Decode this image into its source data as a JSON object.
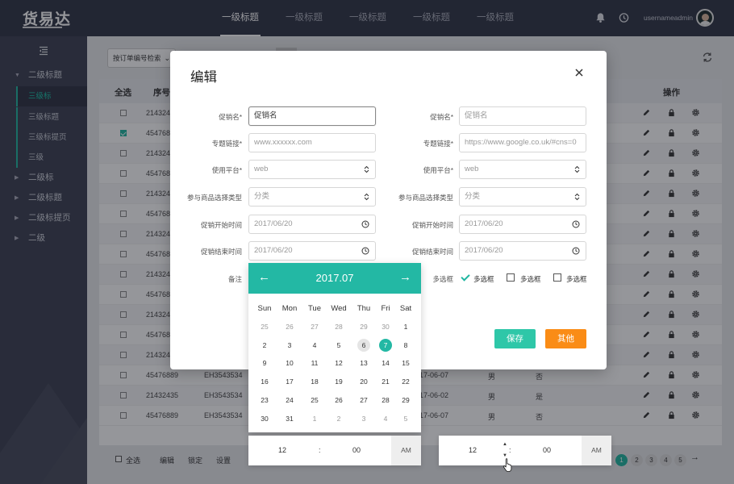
{
  "app": {
    "logo": "货易达",
    "username": "usernameadmin"
  },
  "topnav": [
    "一级标题",
    "一级标题",
    "一级标题",
    "一级标题",
    "一级标题"
  ],
  "sidebar": {
    "groups": [
      {
        "label": "二级标题",
        "expanded": true,
        "children": [
          "三级标",
          "三级标题",
          "三级标提页",
          "三级"
        ]
      },
      {
        "label": "二级标",
        "expanded": false
      },
      {
        "label": "二级标题",
        "expanded": false
      },
      {
        "label": "二级标提页",
        "expanded": false
      },
      {
        "label": "二级",
        "expanded": false
      }
    ]
  },
  "search": {
    "select_label": "按订单编号检索"
  },
  "table": {
    "headers": {
      "select_all": "全选",
      "index": "序号",
      "ops": "操作"
    },
    "rows": [
      {
        "id": "214324",
        "checked": false
      },
      {
        "id": "454768",
        "checked": true
      },
      {
        "id": "214324",
        "checked": false
      },
      {
        "id": "454768",
        "checked": false
      },
      {
        "id": "214324",
        "checked": false
      },
      {
        "id": "454768",
        "checked": false
      },
      {
        "id": "214324",
        "checked": false
      },
      {
        "id": "454768",
        "checked": false
      },
      {
        "id": "214324",
        "checked": false
      },
      {
        "id": "454768",
        "checked": false
      },
      {
        "id": "214324",
        "checked": false
      },
      {
        "id": "454768",
        "checked": false
      },
      {
        "id": "214324",
        "checked": false
      },
      {
        "id": "45476889",
        "code": "EH3543534",
        "date": "17-06-07",
        "gender": "男",
        "flag": "否",
        "checked": false
      },
      {
        "id": "21432435",
        "code": "EH3543534",
        "date": "17-06-02",
        "gender": "男",
        "flag": "是",
        "checked": false
      },
      {
        "id": "45476889",
        "code": "EH3543534",
        "date": "17-06-07",
        "gender": "男",
        "flag": "否",
        "checked": false
      }
    ]
  },
  "footer": {
    "select_all": "全选",
    "edit": "编辑",
    "lock": "锁定",
    "settings": "设置",
    "pages": [
      "1",
      "2",
      "3",
      "4",
      "5"
    ],
    "next": "→"
  },
  "modal": {
    "title": "编辑",
    "left": [
      {
        "label": "促销名*",
        "value": "促销名",
        "focus": true
      },
      {
        "label": "专题链接*",
        "placeholder": "www.xxxxxx.com"
      },
      {
        "label": "使用平台*",
        "placeholder": "web",
        "trail": "select"
      },
      {
        "label": "参与商品选择类型",
        "placeholder": "分类",
        "trail": "select"
      },
      {
        "label": "促销开始时间",
        "placeholder": "2017/06/20",
        "trail": "clock"
      },
      {
        "label": "促销结束时间",
        "placeholder": "2017/06/20",
        "trail": "clock"
      }
    ],
    "right": [
      {
        "label": "促销名*",
        "placeholder": "促销名"
      },
      {
        "label": "专题链接*",
        "placeholder": "https://www.google.co.uk/#cns=0"
      },
      {
        "label": "使用平台*",
        "placeholder": "web",
        "trail": "select"
      },
      {
        "label": "参与商品选择类型",
        "placeholder": "分类",
        "trail": "select"
      },
      {
        "label": "促销开始时间",
        "placeholder": "2017/06/20",
        "trail": "clock"
      },
      {
        "label": "促销结束时间",
        "placeholder": "2017/06/20",
        "trail": "clock"
      }
    ],
    "note_label": "备注",
    "multi_label": "多选框",
    "multi_options": [
      {
        "label": "多选框",
        "checked": true
      },
      {
        "label": "多选框",
        "checked": false
      },
      {
        "label": "多选框",
        "checked": false
      }
    ],
    "save": "保存",
    "other": "其他"
  },
  "datepicker": {
    "month": "2017.07",
    "prev": "←",
    "next": "→",
    "weekdays": [
      "Sun",
      "Mon",
      "Tue",
      "Wed",
      "Thu",
      "Fri",
      "Sat"
    ],
    "weeks": [
      [
        "25",
        "26",
        "27",
        "28",
        "29",
        "30",
        "1"
      ],
      [
        "2",
        "3",
        "4",
        "5",
        "6",
        "7",
        "8"
      ],
      [
        "9",
        "10",
        "11",
        "12",
        "13",
        "14",
        "15"
      ],
      [
        "16",
        "17",
        "18",
        "19",
        "20",
        "21",
        "22"
      ],
      [
        "23",
        "24",
        "25",
        "26",
        "27",
        "28",
        "29"
      ],
      [
        "30",
        "31",
        "1",
        "2",
        "3",
        "4",
        "5"
      ]
    ],
    "today": "6",
    "selected": "7"
  },
  "timepickers": [
    {
      "hour": "12",
      "sep": ":",
      "minute": "00",
      "ampm": "AM"
    },
    {
      "hour": "12",
      "sep": ":",
      "minute": "00",
      "ampm": "AM"
    }
  ],
  "colors": {
    "accent": "#23b8a4",
    "orange": "#fa8c16",
    "topbar": "#2f3344",
    "sidebar": "#3b3f50"
  }
}
